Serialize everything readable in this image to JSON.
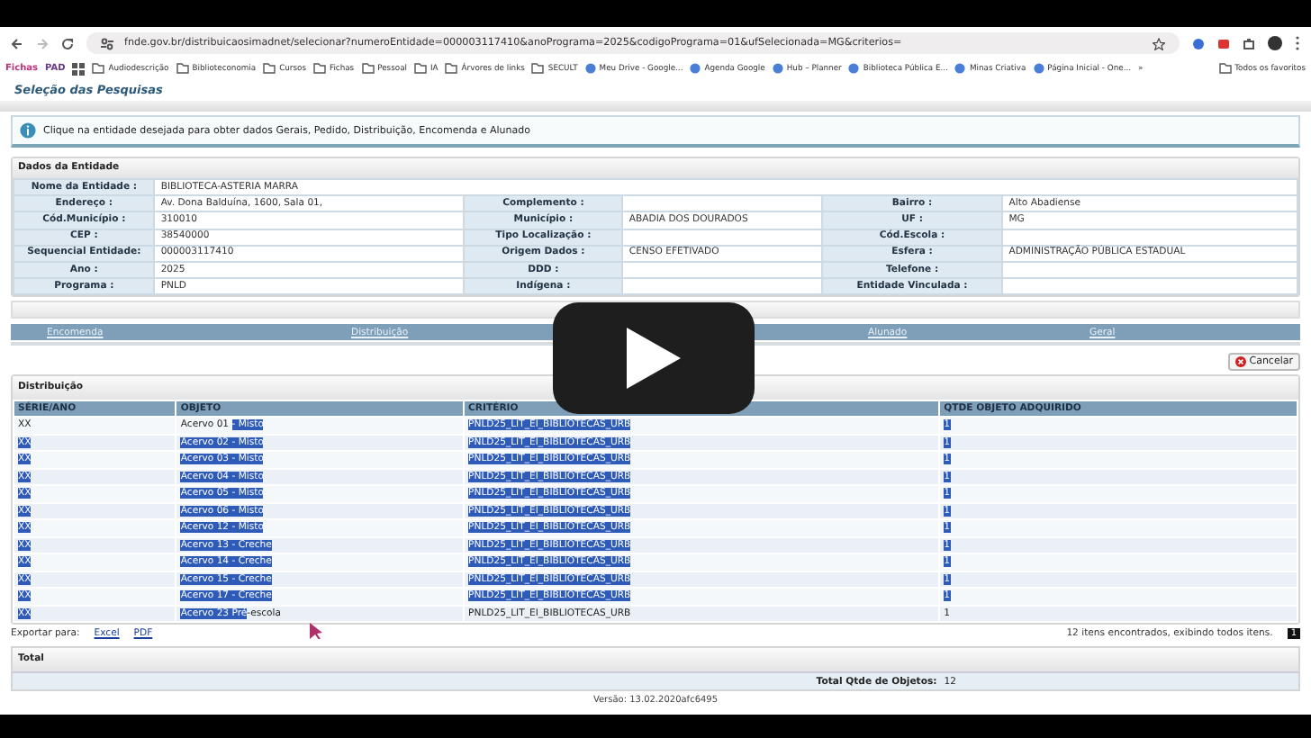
{
  "browser": {
    "url": "fnde.gov.br/distribuicaosimadnet/selecionar?numeroEntidade=000003117410&anoPrograma=2025&codigoPrograma=01&ufSelecionada=MG&criterios=",
    "bookmarks": [
      {
        "label": "Fichas",
        "kind": "label"
      },
      {
        "label": "PAD",
        "kind": "label"
      },
      {
        "kind": "apps"
      },
      {
        "label": "Audiodescrição",
        "kind": "folder"
      },
      {
        "label": "Biblioteconomia",
        "kind": "folder"
      },
      {
        "label": "Cursos",
        "kind": "folder"
      },
      {
        "label": "Fichas",
        "kind": "folder"
      },
      {
        "label": "Pessoal",
        "kind": "folder"
      },
      {
        "label": "IA",
        "kind": "folder"
      },
      {
        "label": "Árvores de links",
        "kind": "folder"
      },
      {
        "label": "SECULT",
        "kind": "folder"
      },
      {
        "label": "Meu Drive - Google...",
        "kind": "site"
      },
      {
        "label": "Agenda Google",
        "kind": "site"
      },
      {
        "label": "Hub – Planner",
        "kind": "site"
      },
      {
        "label": "Biblioteca Pública E...",
        "kind": "site"
      },
      {
        "label": "Minas Criativa",
        "kind": "site"
      },
      {
        "label": "Página Inicial - One...",
        "kind": "site"
      },
      {
        "label": "»",
        "kind": "more"
      },
      {
        "label": "Todos os favoritos",
        "kind": "folder"
      }
    ]
  },
  "page_title": "Seleção das Pesquisas",
  "info": "Clique na entidade desejada para obter dados Gerais, Pedido, Distribuição, Encomenda e Alunado",
  "entity": {
    "title": "Dados da Entidade",
    "rows": [
      [
        {
          "label": "Nome da Entidade :",
          "value": "BIBLIOTECA-ASTERIA MARRA"
        }
      ],
      [
        {
          "label": "Endereço :",
          "value": "Av. Dona Balduína, 1600, Sala 01,"
        },
        {
          "label": "Complemento :"
        },
        {
          "label": "Bairro :",
          "value": "Alto Abadiense"
        }
      ],
      [
        {
          "label": "Cód.Município :",
          "value": "310010"
        },
        {
          "label": "Município :",
          "value": "ABADIA DOS DOURADOS"
        },
        {
          "label": "UF :",
          "value": "MG"
        }
      ],
      [
        {
          "label": "CEP :",
          "value": "38540000"
        },
        {
          "label": "Tipo Localização :"
        },
        {
          "label": "Cód.Escola :"
        }
      ],
      [
        {
          "label": "Sequencial Entidade:",
          "value": "000003117410"
        },
        {
          "label": "Origem Dados :",
          "value": "CENSO EFETIVADO"
        },
        {
          "label": "Esfera :",
          "value": "ADMINISTRAÇÃO PÚBLICA ESTADUAL"
        }
      ],
      [
        {
          "label": "Ano :",
          "value": "2025"
        },
        {
          "label": "DDD :"
        },
        {
          "label": "Telefone :"
        }
      ],
      [
        {
          "label": "Programa :",
          "value": "PNLD"
        },
        {
          "label": "Indígena :"
        },
        {
          "label": "Entidade Vinculada :"
        }
      ]
    ]
  },
  "tabs": [
    {
      "label": "Encomenda"
    },
    {
      "label": "Distribuição"
    },
    {
      "label": "Alunado"
    },
    {
      "label": "Geral"
    }
  ],
  "cancel_button": "Cancelar",
  "distribution": {
    "title": "Distribuição",
    "columns": [
      "SÉRIE/ANO",
      "OBJETO",
      "CRITÉRIO",
      "QTDE OBJETO ADQUIRIDO"
    ],
    "rows": [
      [
        [
          {
            "text": "XX",
            "highlighted": false
          }
        ],
        [
          {
            "text": "Acervo 01 ",
            "highlighted": false
          },
          {
            "text": "- Misto",
            "highlighted": true
          }
        ],
        [
          {
            "text": "PNLD25_LIT_EI_BIBLIOTECAS_URB",
            "highlighted": true
          }
        ],
        [
          {
            "text": "1",
            "highlighted": true
          }
        ]
      ],
      [
        [
          {
            "text": "XX",
            "highlighted": true
          }
        ],
        [
          {
            "text": "Acervo 02 - Misto",
            "highlighted": true
          }
        ],
        [
          {
            "text": "PNLD25_LIT_EI_BIBLIOTECAS_URB",
            "highlighted": true
          }
        ],
        [
          {
            "text": "1",
            "highlighted": true
          }
        ]
      ],
      [
        [
          {
            "text": "XX",
            "highlighted": true
          }
        ],
        [
          {
            "text": "Acervo 03 - Misto",
            "highlighted": true
          }
        ],
        [
          {
            "text": "PNLD25_LIT_EI_BIBLIOTECAS_URB",
            "highlighted": true
          }
        ],
        [
          {
            "text": "1",
            "highlighted": true
          }
        ]
      ],
      [
        [
          {
            "text": "XX",
            "highlighted": true
          }
        ],
        [
          {
            "text": "Acervo 04 - Misto",
            "highlighted": true
          }
        ],
        [
          {
            "text": "PNLD25_LIT_EI_BIBLIOTECAS_URB",
            "highlighted": true
          }
        ],
        [
          {
            "text": "1",
            "highlighted": true
          }
        ]
      ],
      [
        [
          {
            "text": "XX",
            "highlighted": true
          }
        ],
        [
          {
            "text": "Acervo 05 - Misto",
            "highlighted": true
          }
        ],
        [
          {
            "text": "PNLD25_LIT_EI_BIBLIOTECAS_URB",
            "highlighted": true
          }
        ],
        [
          {
            "text": "1",
            "highlighted": true
          }
        ]
      ],
      [
        [
          {
            "text": "XX",
            "highlighted": true
          }
        ],
        [
          {
            "text": "Acervo 06 - Misto",
            "highlighted": true
          }
        ],
        [
          {
            "text": "PNLD25_LIT_EI_BIBLIOTECAS_URB",
            "highlighted": true
          }
        ],
        [
          {
            "text": "1",
            "highlighted": true
          }
        ]
      ],
      [
        [
          {
            "text": "XX",
            "highlighted": true
          }
        ],
        [
          {
            "text": "Acervo 12 - Misto",
            "highlighted": true
          }
        ],
        [
          {
            "text": "PNLD25_LIT_EI_BIBLIOTECAS_URB",
            "highlighted": true
          }
        ],
        [
          {
            "text": "1",
            "highlighted": true
          }
        ]
      ],
      [
        [
          {
            "text": "XX",
            "highlighted": true
          }
        ],
        [
          {
            "text": "Acervo 13 - Creche",
            "highlighted": true
          }
        ],
        [
          {
            "text": "PNLD25_LIT_EI_BIBLIOTECAS_URB",
            "highlighted": true
          }
        ],
        [
          {
            "text": "1",
            "highlighted": true
          }
        ]
      ],
      [
        [
          {
            "text": "XX",
            "highlighted": true
          }
        ],
        [
          {
            "text": "Acervo 14 - Creche",
            "highlighted": true
          }
        ],
        [
          {
            "text": "PNLD25_LIT_EI_BIBLIOTECAS_URB",
            "highlighted": true
          }
        ],
        [
          {
            "text": "1",
            "highlighted": true
          }
        ]
      ],
      [
        [
          {
            "text": "XX",
            "highlighted": true
          }
        ],
        [
          {
            "text": "Acervo 15 - Creche",
            "highlighted": true
          }
        ],
        [
          {
            "text": "PNLD25_LIT_EI_BIBLIOTECAS_URB",
            "highlighted": true
          }
        ],
        [
          {
            "text": "1",
            "highlighted": true
          }
        ]
      ],
      [
        [
          {
            "text": "XX",
            "highlighted": true
          }
        ],
        [
          {
            "text": "Acervo 17 - Creche",
            "highlighted": true
          }
        ],
        [
          {
            "text": "PNLD25_LIT_EI_BIBLIOTECAS_URB",
            "highlighted": true
          }
        ],
        [
          {
            "text": "1",
            "highlighted": true
          }
        ]
      ],
      [
        [
          {
            "text": "XX",
            "highlighted": true
          }
        ],
        [
          {
            "text": "Acervo 23 Pré",
            "highlighted": true
          },
          {
            "text": "-escola",
            "highlighted": false
          }
        ],
        [
          {
            "text": "PNLD25_LIT_EI_BIBLIOTECAS_URB",
            "highlighted": false
          }
        ],
        [
          {
            "text": "1",
            "highlighted": false
          }
        ]
      ]
    ]
  },
  "export": {
    "label": "Exportar para:",
    "links": [
      "Excel",
      "PDF"
    ],
    "summary": "12 itens encontrados, exibindo todos itens.",
    "page": "1"
  },
  "total": {
    "title": "Total",
    "label": "Total Qtde de Objetos:",
    "value": "12"
  },
  "version": "Versão: 13.02.2020afc6495"
}
